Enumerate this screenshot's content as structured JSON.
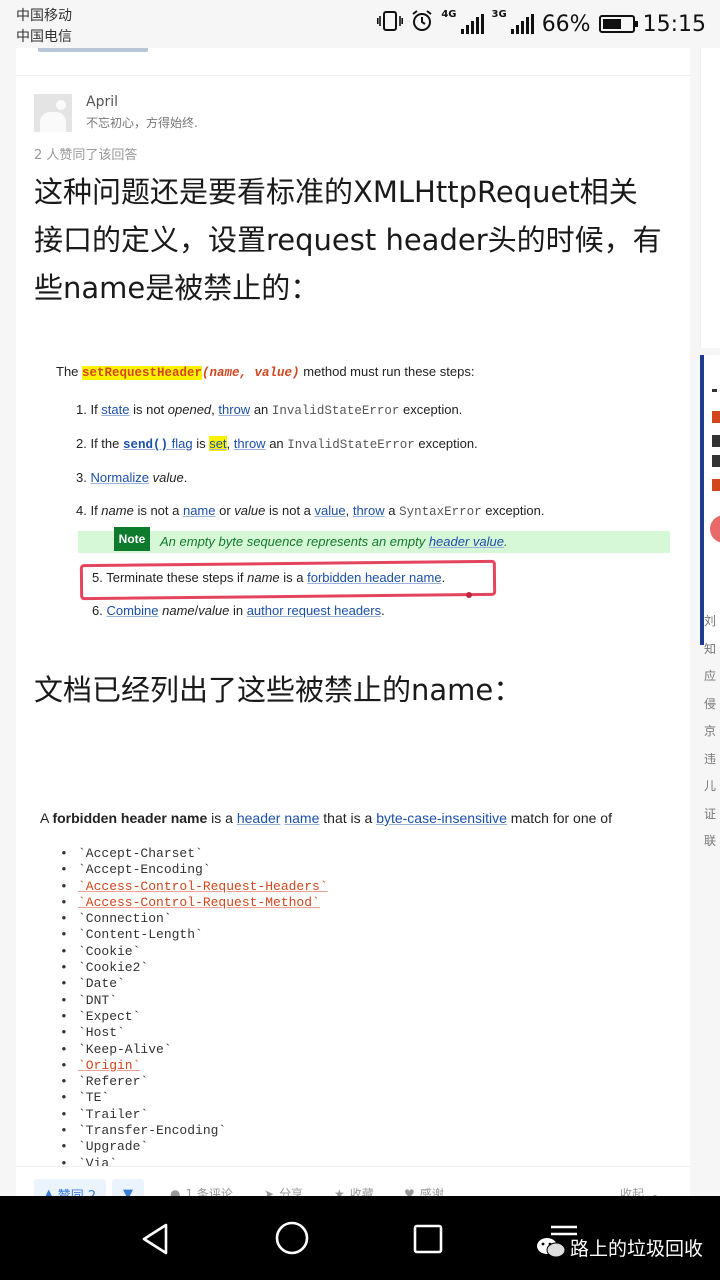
{
  "status_bar": {
    "carrier_1": "中国移动",
    "carrier_2": "中国电信",
    "net_1": "4G",
    "net_2": "3G",
    "battery_percent": "66%",
    "battery_level": 0.66,
    "time": "15:15"
  },
  "answer": {
    "author_name": "April",
    "author_bio": "不忘初心，方得始终.",
    "votes_note": "2 人赞同了该回答",
    "paragraph_1_lines": [
      "这种问题还是要看标准的XMLHttpRequet相关",
      "接口的定义，设置request header头的时候，有",
      "些name是被禁止的："
    ],
    "paragraph_2": "文档已经列出了这些被禁止的name："
  },
  "spec_figure": {
    "intro_prefix": "The ",
    "intro_method": "setRequestHeader",
    "intro_args": "(name, value)",
    "intro_suffix": " method must run these steps:",
    "step1": {
      "a": "1. If ",
      "b": "state",
      "c": " is not ",
      "d": "opened",
      "e": ", ",
      "f": "throw",
      "g": " an ",
      "h": "InvalidStateError",
      "i": " exception."
    },
    "step2": {
      "a": "2. If the ",
      "b": "send()",
      "c": " flag",
      "d": " is ",
      "e": "set",
      "f": ", ",
      "g": "throw",
      "h": " an ",
      "i": "InvalidStateError",
      "j": " exception."
    },
    "step3": {
      "a": "3. ",
      "b": "Normalize",
      "c": " value",
      "d": "."
    },
    "step4": {
      "a": "4. If ",
      "b": "name",
      "c": " is not a ",
      "d": "name",
      "e": " or ",
      "f": "value",
      "g": " is not a ",
      "h": "value",
      "i": ", ",
      "j": "throw",
      "k": " a ",
      "l": "SyntaxError",
      "m": " exception."
    },
    "note_badge": "Note",
    "note_text_a": "An empty byte sequence represents an empty ",
    "note_text_b": "header value",
    "note_text_c": ".",
    "step5": {
      "a": "5. Terminate these steps if ",
      "b": "name",
      "c": " is a ",
      "d": "forbidden header name",
      "e": "."
    },
    "step6": {
      "a": "6. ",
      "b": "Combine",
      "c": " name",
      "d": "/",
      "e": "value",
      "f": " in ",
      "g": "author request headers",
      "h": "."
    }
  },
  "names_figure": {
    "intro_a": "A ",
    "intro_b": "forbidden header name",
    "intro_c": " is a ",
    "intro_d": "header",
    "intro_e": " ",
    "intro_f": "name",
    "intro_g": " that is a ",
    "intro_h": "byte-case-insensitive",
    "intro_i": " match for one of",
    "items": [
      {
        "name": "`Accept-Charset`",
        "red": false
      },
      {
        "name": "`Accept-Encoding`",
        "red": false
      },
      {
        "name": "`Access-Control-Request-Headers`",
        "red": true
      },
      {
        "name": "`Access-Control-Request-Method`",
        "red": true
      },
      {
        "name": "`Connection`",
        "red": false
      },
      {
        "name": "`Content-Length`",
        "red": false
      },
      {
        "name": "`Cookie`",
        "red": false
      },
      {
        "name": "`Cookie2`",
        "red": false
      },
      {
        "name": "`Date`",
        "red": false
      },
      {
        "name": "`DNT`",
        "red": false
      },
      {
        "name": "`Expect`",
        "red": false
      },
      {
        "name": "`Host`",
        "red": false
      },
      {
        "name": "`Keep-Alive`",
        "red": false
      },
      {
        "name": "`Origin`",
        "red": true
      },
      {
        "name": "`Referer`",
        "red": false
      },
      {
        "name": "`TE`",
        "red": false
      },
      {
        "name": "`Trailer`",
        "red": false
      },
      {
        "name": "`Transfer-Encoding`",
        "red": false
      },
      {
        "name": "`Upgrade`",
        "red": false
      },
      {
        "name": "`Via`",
        "red": false
      }
    ]
  },
  "action_bar": {
    "upvote_label": "赞同 2",
    "comments_label": "1 条评论",
    "share_label": "分享",
    "collect_label": "收藏",
    "thanks_label": "感谢",
    "collapse_label": "收起"
  },
  "side_peek_chars": [
    "刘",
    "知",
    "应",
    "侵",
    "京",
    "违",
    "儿",
    "证",
    "联"
  ],
  "watermark": "路上的垃圾回收",
  "colors": {
    "link": "#1b4fa8",
    "accent_blue": "#3b7ddd",
    "code_orange": "#d2461e",
    "note_green": "#0d7a2c",
    "red_annotation": "#e4455d"
  }
}
